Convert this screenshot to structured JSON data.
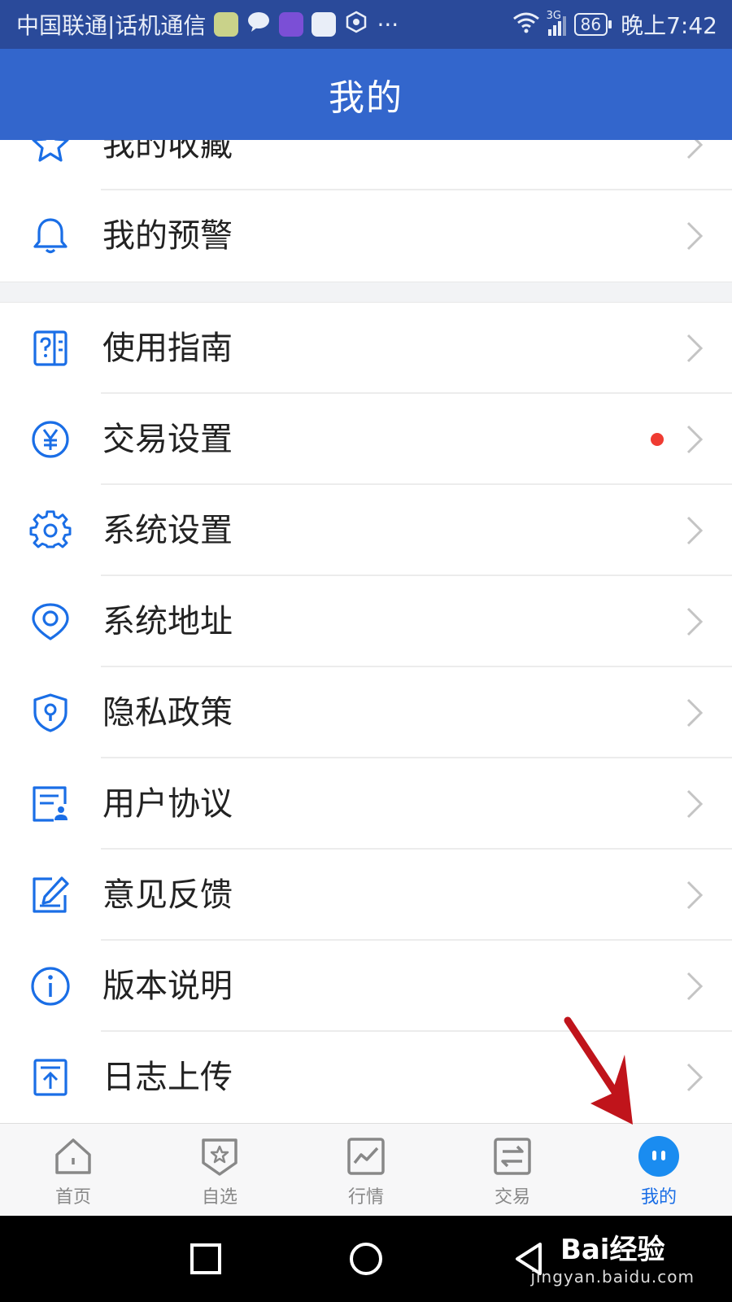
{
  "status_bar": {
    "carrier": "中国联通|话机通信",
    "network": "3G",
    "battery": "86",
    "time": "晚上7:42"
  },
  "header": {
    "title": "我的"
  },
  "menu_group_1": [
    {
      "label": "我的收藏",
      "icon": "star-icon"
    },
    {
      "label": "我的预警",
      "icon": "bell-icon"
    }
  ],
  "menu_group_2": [
    {
      "label": "使用指南",
      "icon": "guide-icon"
    },
    {
      "label": "交易设置",
      "icon": "yuan-icon",
      "badge": "red-dot"
    },
    {
      "label": "系统设置",
      "icon": "gear-icon"
    },
    {
      "label": "系统地址",
      "icon": "location-icon"
    },
    {
      "label": "隐私政策",
      "icon": "shield-lock-icon"
    },
    {
      "label": "用户协议",
      "icon": "agreement-icon"
    },
    {
      "label": "意见反馈",
      "icon": "edit-icon"
    },
    {
      "label": "版本说明",
      "icon": "info-icon"
    },
    {
      "label": "日志上传",
      "icon": "upload-icon"
    }
  ],
  "tab_bar": [
    {
      "label": "首页",
      "icon": "home-icon",
      "active": false
    },
    {
      "label": "自选",
      "icon": "star-shield-icon",
      "active": false
    },
    {
      "label": "行情",
      "icon": "chart-icon",
      "active": false
    },
    {
      "label": "交易",
      "icon": "swap-icon",
      "active": false
    },
    {
      "label": "我的",
      "icon": "profile-face-icon",
      "active": true
    }
  ],
  "watermark": {
    "main": "Bai经验",
    "sub": "jingyan.baidu.com"
  },
  "colors": {
    "primary": "#3366cc",
    "status_bar": "#2a4a9a",
    "icon_blue": "#1a6ee6",
    "badge_red": "#ef3b32",
    "arrow_red": "#c0141b"
  }
}
